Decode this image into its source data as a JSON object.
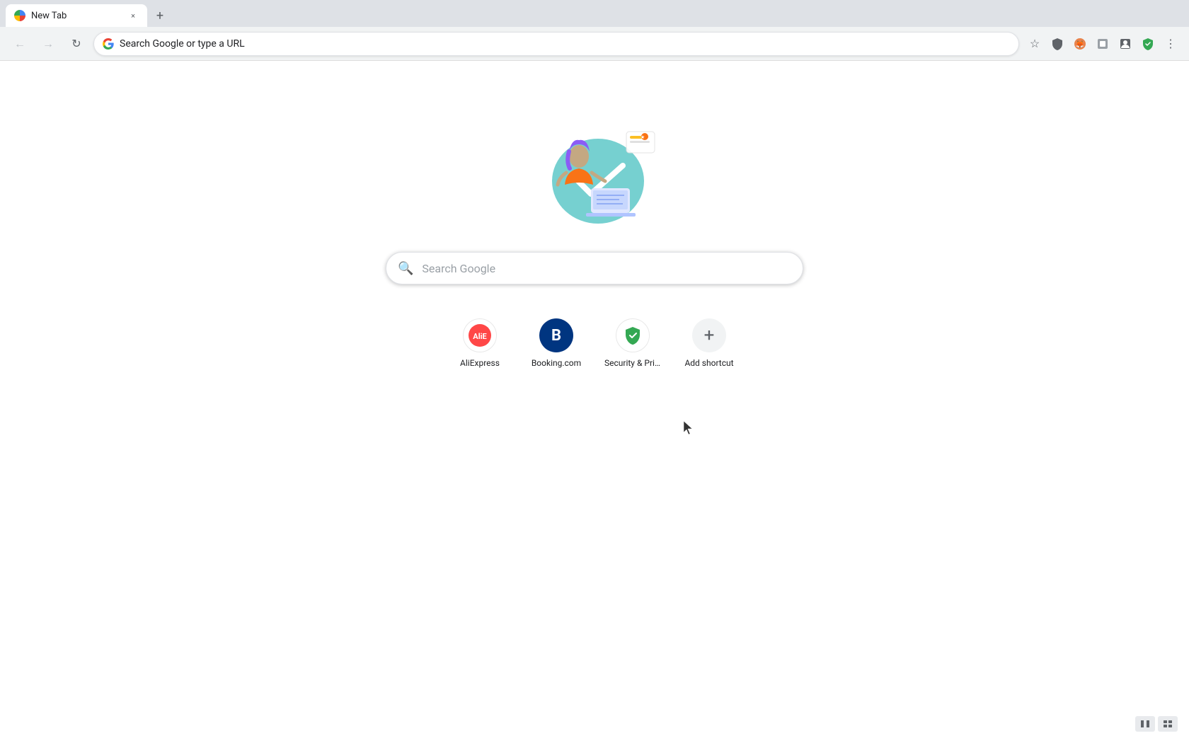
{
  "browser": {
    "tab": {
      "title": "New Tab",
      "close_label": "×"
    },
    "new_tab_label": "+",
    "toolbar": {
      "back_label": "←",
      "forward_label": "→",
      "reload_label": "↻",
      "address_placeholder": "Search Google or type a URL",
      "bookmark_icon": "☆",
      "menu_icon": "⋮"
    }
  },
  "page": {
    "search": {
      "placeholder": "Search Google"
    },
    "shortcuts": [
      {
        "id": "aliexpress",
        "label": "AliExpress",
        "icon_text": ""
      },
      {
        "id": "booking",
        "label": "Booking.com",
        "icon_text": "B"
      },
      {
        "id": "security",
        "label": "Security & Priv...",
        "icon_text": "✓"
      },
      {
        "id": "add-shortcut",
        "label": "Add shortcut",
        "icon_text": "+"
      }
    ]
  },
  "bottom_controls": {
    "btn1": "▐▌",
    "btn2": "⊡"
  }
}
